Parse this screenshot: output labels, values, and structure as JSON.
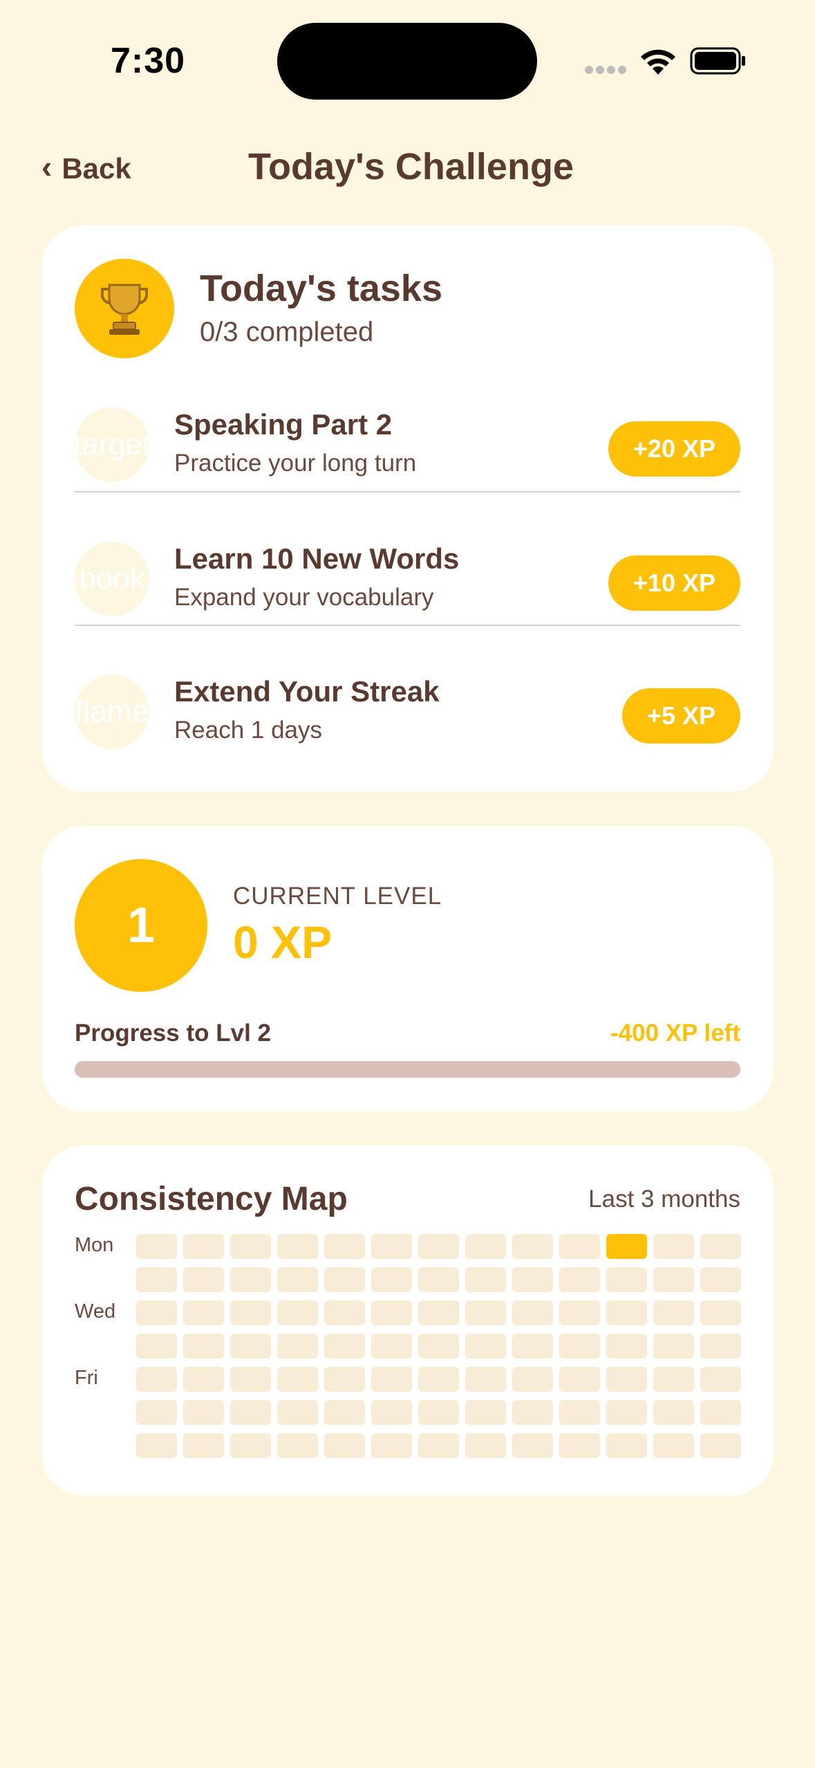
{
  "status_bar": {
    "time": "7:30"
  },
  "nav": {
    "back_label": "Back",
    "back_chevron": "‹",
    "title": "Today's Challenge"
  },
  "tasks_card": {
    "title": "Today's tasks",
    "subtitle": "0/3 completed",
    "icon": "trophy-icon",
    "tasks": [
      {
        "icon_text": "target",
        "name": "Speaking Part 2",
        "description": "Practice your long turn",
        "xp": "+20 XP"
      },
      {
        "icon_text": "book",
        "name": "Learn 10 New Words",
        "description": "Expand your vocabulary",
        "xp": "+10 XP"
      },
      {
        "icon_text": "flame",
        "name": "Extend Your Streak",
        "description": "Reach 1 days",
        "xp": "+5 XP"
      }
    ]
  },
  "level_card": {
    "level": "1",
    "label": "CURRENT LEVEL",
    "xp": "0 XP",
    "progress_label": "Progress to Lvl 2",
    "progress_left": "-400 XP left",
    "progress_fraction": 0
  },
  "map_card": {
    "title": "Consistency Map",
    "range": "Last 3 months",
    "day_labels": [
      "Mon",
      "Wed",
      "Fri"
    ],
    "rows": 7,
    "cols": 13,
    "active_cells": [
      [
        0,
        10
      ]
    ]
  },
  "colors": {
    "background": "#FEF7DF",
    "accent": "#FFC107",
    "text": "#5A3A2E",
    "card": "#FFFFFF",
    "cell_empty": "#F8ECD6",
    "progress_track": "#D9BFB5"
  }
}
